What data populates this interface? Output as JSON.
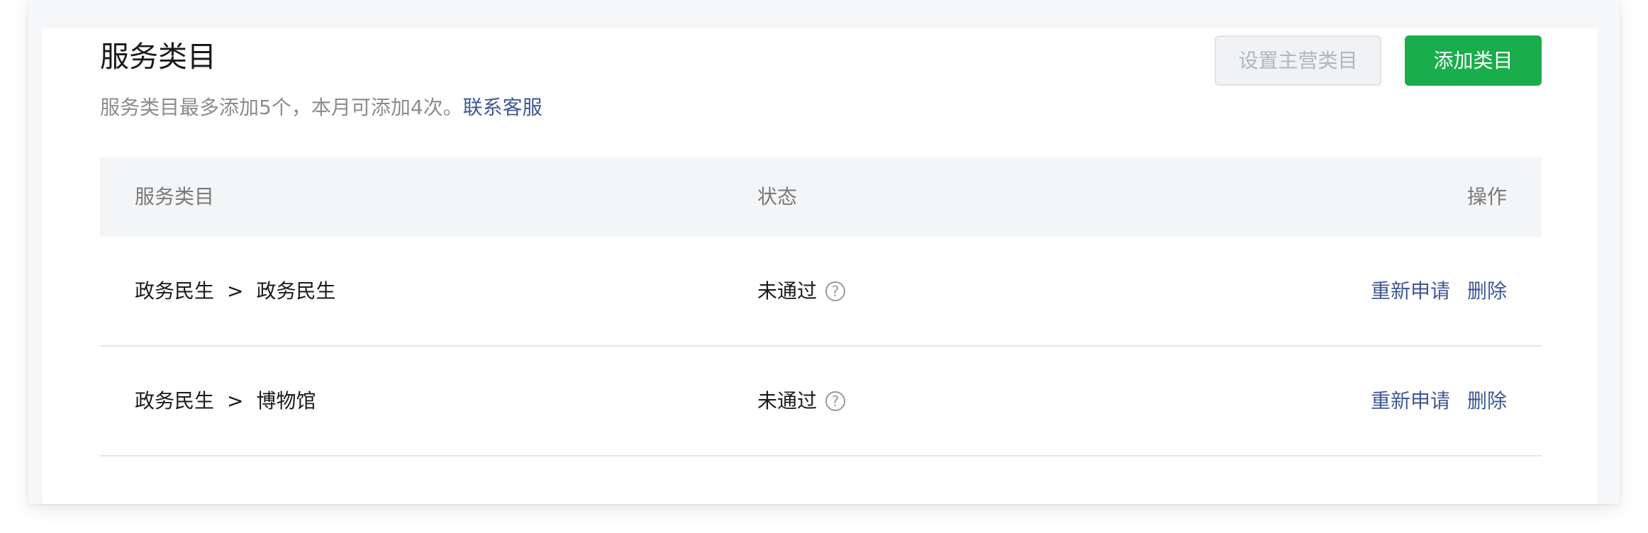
{
  "header": {
    "title": "服务类目",
    "subtitle_text": "服务类目最多添加5个，本月可添加4次。",
    "contact_link": "联系客服"
  },
  "buttons": {
    "set_primary_label": "设置主营类目",
    "add_category_label": "添加类目"
  },
  "table": {
    "columns": [
      "服务类目",
      "状态",
      "操作"
    ],
    "rows": [
      {
        "category_parent": "政务民生",
        "separator": ">",
        "category_child": "政务民生",
        "status": "未通过",
        "help_glyph": "?",
        "actions": [
          "重新申请",
          "删除"
        ]
      },
      {
        "category_parent": "政务民生",
        "separator": ">",
        "category_child": "博物馆",
        "status": "未通过",
        "help_glyph": "?",
        "actions": [
          "重新申请",
          "删除"
        ]
      }
    ]
  },
  "colors": {
    "primary_green": "#1aad4b",
    "link_blue": "#3f5895",
    "header_bg": "#f4f5f7"
  },
  "icons": {
    "help": "question-circle-icon"
  }
}
